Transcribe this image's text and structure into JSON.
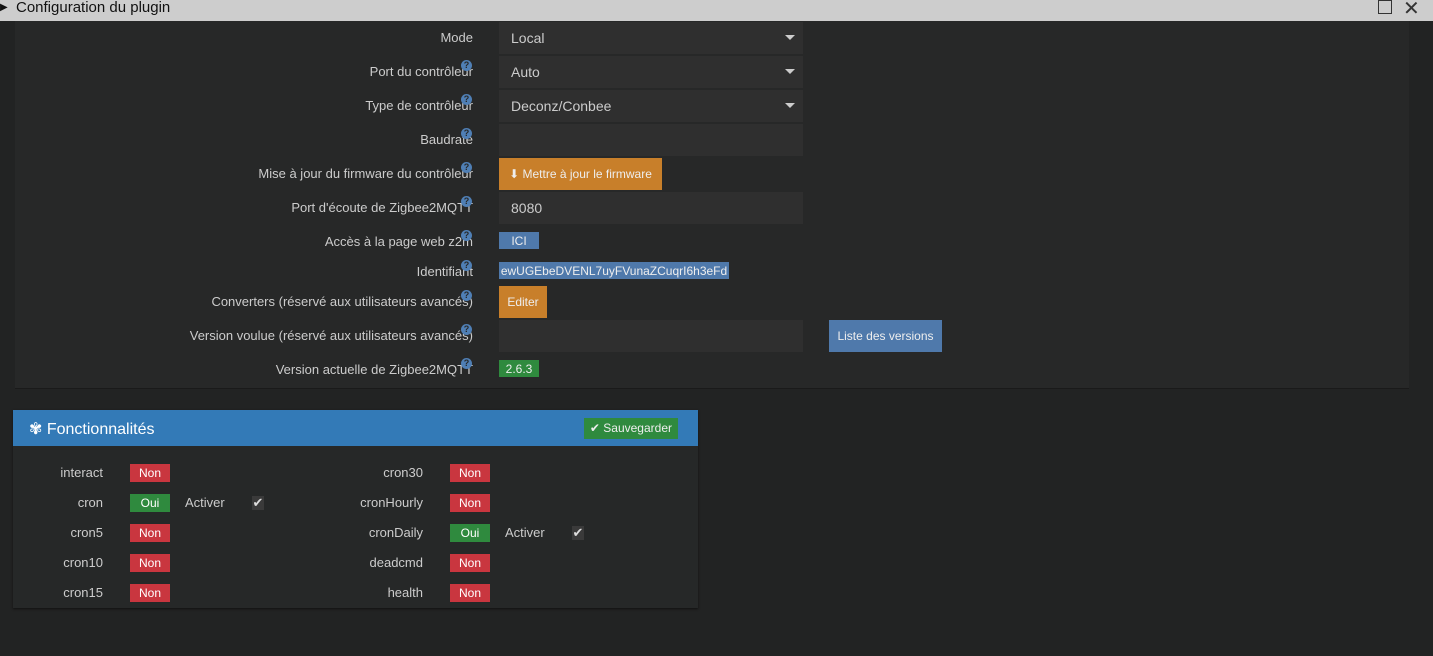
{
  "window": {
    "title": "Configuration du plugin"
  },
  "config": {
    "mode": {
      "label": "Mode",
      "value": "Local"
    },
    "port": {
      "label": "Port du contrôleur",
      "value": "Auto"
    },
    "type": {
      "label": "Type de contrôleur",
      "value": "Deconz/Conbee"
    },
    "baudrate": {
      "label": "Baudrate",
      "value": ""
    },
    "firmware": {
      "label": "Mise à jour du firmware du contrôleur",
      "button": "Mettre à jour le firmware"
    },
    "listen_port": {
      "label": "Port d'écoute de Zigbee2MQTT",
      "value": "8080"
    },
    "webpage": {
      "label": "Accès à la page web z2m",
      "button": "ICI"
    },
    "identifier": {
      "label": "Identifiant",
      "value": "ewUGEbeDVENL7uyFVunaZCuqrI6h3eFd"
    },
    "converters": {
      "label": "Converters (réservé aux utilisateurs avancés)",
      "button": "Editer"
    },
    "wanted_version": {
      "label": "Version voulue (réservé aux utilisateurs avancés)",
      "value": "",
      "button": "Liste des versions"
    },
    "current_version": {
      "label": "Version actuelle de Zigbee2MQTT",
      "value": "2.6.3"
    }
  },
  "features": {
    "title": "Fonctionnalités",
    "save": "Sauvegarder",
    "activate": "Activer",
    "left": [
      {
        "name": "interact",
        "state": "Non"
      },
      {
        "name": "cron",
        "state": "Oui",
        "activer": true
      },
      {
        "name": "cron5",
        "state": "Non"
      },
      {
        "name": "cron10",
        "state": "Non"
      },
      {
        "name": "cron15",
        "state": "Non"
      }
    ],
    "right": [
      {
        "name": "cron30",
        "state": "Non"
      },
      {
        "name": "cronHourly",
        "state": "Non"
      },
      {
        "name": "cronDaily",
        "state": "Oui",
        "activer": true
      },
      {
        "name": "deadcmd",
        "state": "Non"
      },
      {
        "name": "health",
        "state": "Non"
      }
    ]
  }
}
